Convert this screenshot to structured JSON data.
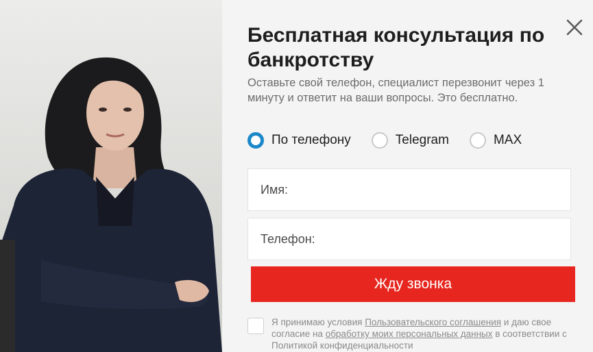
{
  "modal": {
    "title": "Бесплатная консультация по банкротству",
    "subtitle": "Оставьте свой телефон, специалист перезвонит через 1 минуту и ответит на ваши вопросы. Это бесплатно.",
    "close_icon": "close-icon"
  },
  "contact_methods": [
    {
      "label": "По телефону",
      "selected": true
    },
    {
      "label": "Telegram",
      "selected": false
    },
    {
      "label": "MAX",
      "selected": false
    }
  ],
  "form": {
    "name_placeholder": "Имя:",
    "phone_placeholder": "Телефон:",
    "submit_label": "Жду звонка"
  },
  "consent": {
    "text_1": "Я принимаю условия ",
    "link_1": "Пользовательского соглашения",
    "text_2": " и даю свое согласие на ",
    "link_2": "обработку моих персональных данных",
    "text_3": " в соответствии с Политикой конфиденциальности",
    "checked": false
  },
  "colors": {
    "accent_red": "#e6261f",
    "radio_blue": "#1a88c9",
    "panel_bg": "#f4f4f4"
  }
}
